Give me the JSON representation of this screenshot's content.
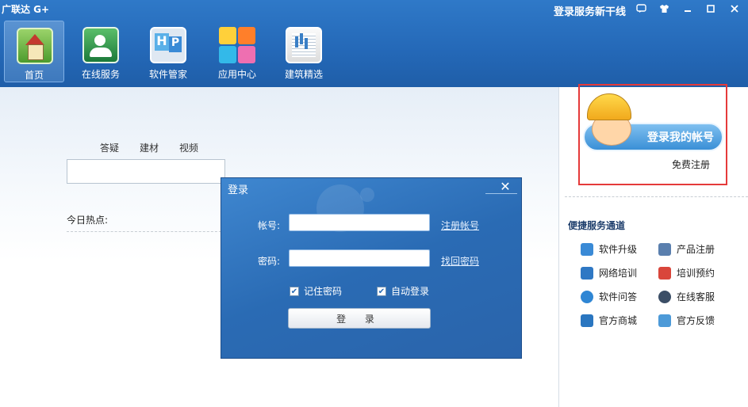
{
  "window": {
    "app_title": "广联达 G+",
    "notice": "登录服务新干线",
    "controls": [
      "chat-icon",
      "shirt-icon",
      "minimize-icon",
      "maximize-icon",
      "close-icon"
    ]
  },
  "nav": {
    "tabs": [
      {
        "label": "首页",
        "icon": "home-icon",
        "active": true
      },
      {
        "label": "在线服务",
        "icon": "users-icon",
        "active": false
      },
      {
        "label": "软件管家",
        "icon": "software-manager-icon",
        "active": false
      },
      {
        "label": "应用中心",
        "icon": "app-center-icon",
        "active": false
      },
      {
        "label": "建筑精选",
        "icon": "book-icon",
        "active": false
      }
    ]
  },
  "main": {
    "categories": [
      "答疑",
      "建材",
      "视频"
    ],
    "search_placeholder": "",
    "hot_label": "今日热点:"
  },
  "dialog": {
    "title": "登录",
    "close": "✕",
    "account_label": "帐号:",
    "account_value": "",
    "register_link": "注册帐号",
    "password_label": "密码:",
    "password_value": "",
    "recover_link": "找回密码",
    "remember_label": "记住密码",
    "remember_checked": true,
    "autologin_label": "自动登录",
    "autologin_checked": true,
    "login_button": "登 录"
  },
  "sidebar": {
    "login_button": "登录我的帐号",
    "free_register": "免费注册",
    "services_title": "便捷服务通道",
    "services": [
      {
        "label": "软件升级",
        "icon": "upgrade-icon",
        "color": "#3a8ad6"
      },
      {
        "label": "产品注册",
        "icon": "product-register-icon",
        "color": "#5a7fae"
      },
      {
        "label": "网络培训",
        "icon": "monitor-icon",
        "color": "#2f78c4"
      },
      {
        "label": "培训预约",
        "icon": "calendar-icon",
        "color": "#d9463b"
      },
      {
        "label": "软件问答",
        "icon": "chat-bubble-icon",
        "color": "#2f86d4"
      },
      {
        "label": "在线客服",
        "icon": "agent-icon",
        "color": "#3b4e66"
      },
      {
        "label": "官方商城",
        "icon": "cart-icon",
        "color": "#2a76c0"
      },
      {
        "label": "官方反馈",
        "icon": "feedback-icon",
        "color": "#4d9ad8"
      }
    ]
  },
  "colors": {
    "topbar": "#2468b7",
    "dialog": "#2a6bb4",
    "promo_border": "#e53a3a"
  }
}
